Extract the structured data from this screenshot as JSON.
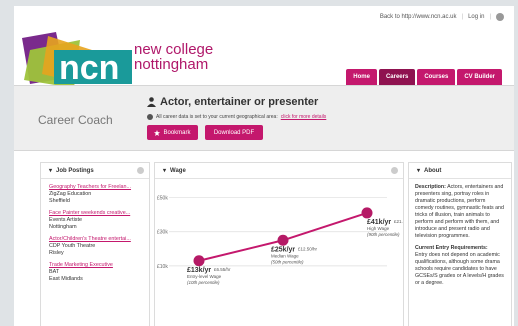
{
  "header": {
    "back_link": "Back to http://www.ncn.ac.uk",
    "login": "Log in",
    "logo_letters": "ncn",
    "brand_line1": "new college",
    "brand_line2": "nottingham",
    "nav": [
      "Home",
      "Careers",
      "Courses",
      "CV Builder"
    ]
  },
  "coach": {
    "title": "Career Coach",
    "role": "Actor, entertainer or presenter",
    "note": "All career data is set to your current geographical area:",
    "note_link": "click for more details",
    "bookmark": "Bookmark",
    "download": "Download PDF"
  },
  "jobs": {
    "title": "Job Postings",
    "items": [
      {
        "title": "Geography Teachers for Freelan...",
        "employer": "ZigZag Education",
        "location": "Sheffield"
      },
      {
        "title": "Face Painter weekends creative...",
        "employer": "Events Artiste",
        "location": "Nottingham"
      },
      {
        "title": "Actor/Children's Theatre entertai...",
        "employer": "CDP Youth Theatre",
        "location": "Risley"
      },
      {
        "title": "Trade Marketing Executive",
        "employer": "BAT",
        "location": "East Midlands"
      }
    ]
  },
  "wage": {
    "title": "Wage",
    "y_ticks": [
      "£50k",
      "£30k",
      "£10k"
    ],
    "points": [
      {
        "label": "£13k/yr",
        "hourly": "£6.55/hr",
        "desc": "Entry-level Wage",
        "pct": "(10th percentile)"
      },
      {
        "label": "£25k/yr",
        "hourly": "£12.50/hr",
        "desc": "Median Wage",
        "pct": "(50th percentile)"
      },
      {
        "label": "£41k/yr",
        "hourly": "£21.27/hr",
        "desc": "High Wage",
        "pct": "(90th percentile)"
      }
    ]
  },
  "chart_data": {
    "type": "line",
    "categories": [
      "Entry-level Wage",
      "Median Wage",
      "High Wage"
    ],
    "values": [
      13,
      25,
      41
    ],
    "ylim": [
      0,
      55
    ],
    "ylabel": "",
    "xlabel": "",
    "title": "Wage"
  },
  "about": {
    "title": "About",
    "desc_label": "Description:",
    "desc": "Actors, entertainers and presenters sing, portray roles in dramatic productions, perform comedy routines, gymnastic feats and tricks of illusion, train animals to perform and perform with them, and introduce and present radio and television programmes.",
    "entry_label": "Current Entry Requirements:",
    "entry": "Entry does not depend on academic qualifications, although some drama schools require candidates to have GCSEs/S grades or A levels/H grades or a degree."
  },
  "colors": {
    "brand": "#c4186d",
    "brand_dark": "#8f1250",
    "logo_green": "#9ec33b",
    "logo_teal": "#1a9a9a",
    "logo_purple": "#7a2a8c"
  }
}
